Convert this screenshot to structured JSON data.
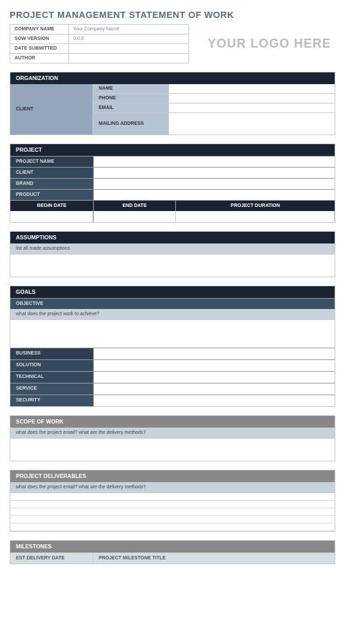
{
  "title": "PROJECT MANAGEMENT STATEMENT OF WORK",
  "logo_placeholder": "YOUR LOGO HERE",
  "meta": {
    "company_name_label": "COMPANY NAME",
    "company_name_value": "Your Company Name",
    "sow_version_label": "SOW VERSION",
    "sow_version_value": "0.0.0",
    "date_submitted_label": "DATE SUBMITTED",
    "date_submitted_value": "",
    "author_label": "AUTHOR",
    "author_value": ""
  },
  "organization": {
    "header": "ORGANIZATION",
    "client_label": "CLIENT",
    "fields": {
      "name": "NAME",
      "phone": "PHONE",
      "email": "EMAIL",
      "mailing": "MAILING ADDRESS"
    }
  },
  "project": {
    "header": "PROJECT",
    "project_name": "PROJECT NAME",
    "client": "CLIENT",
    "brand": "BRAND",
    "product": "PRODUCT",
    "begin_date": "BEGIN DATE",
    "end_date": "END DATE",
    "duration": "PROJECT DURATION"
  },
  "assumptions": {
    "header": "ASSUMPTIONS",
    "hint": "list all made assumptions"
  },
  "goals": {
    "header": "GOALS",
    "objective": "OBJECTIVE",
    "hint": "what does the project work to achieve?",
    "rows": {
      "business": "BUSINESS",
      "solution": "SOLUTION",
      "technical": "TECHNICAL",
      "service": "SERVICE",
      "security": "SECURITY"
    }
  },
  "scope": {
    "header": "SCOPE OF WORK",
    "hint": "what does the project entail? what are the delivery methods?"
  },
  "deliverables": {
    "header": "PROJECT DELIVERABLES",
    "hint": "what does the project entail? what are the delivery methods?"
  },
  "milestones": {
    "header": "MILESTONES",
    "est_date": "EST DELIVERY DATE",
    "title": "PROJECT MILESTONE TITLE"
  }
}
